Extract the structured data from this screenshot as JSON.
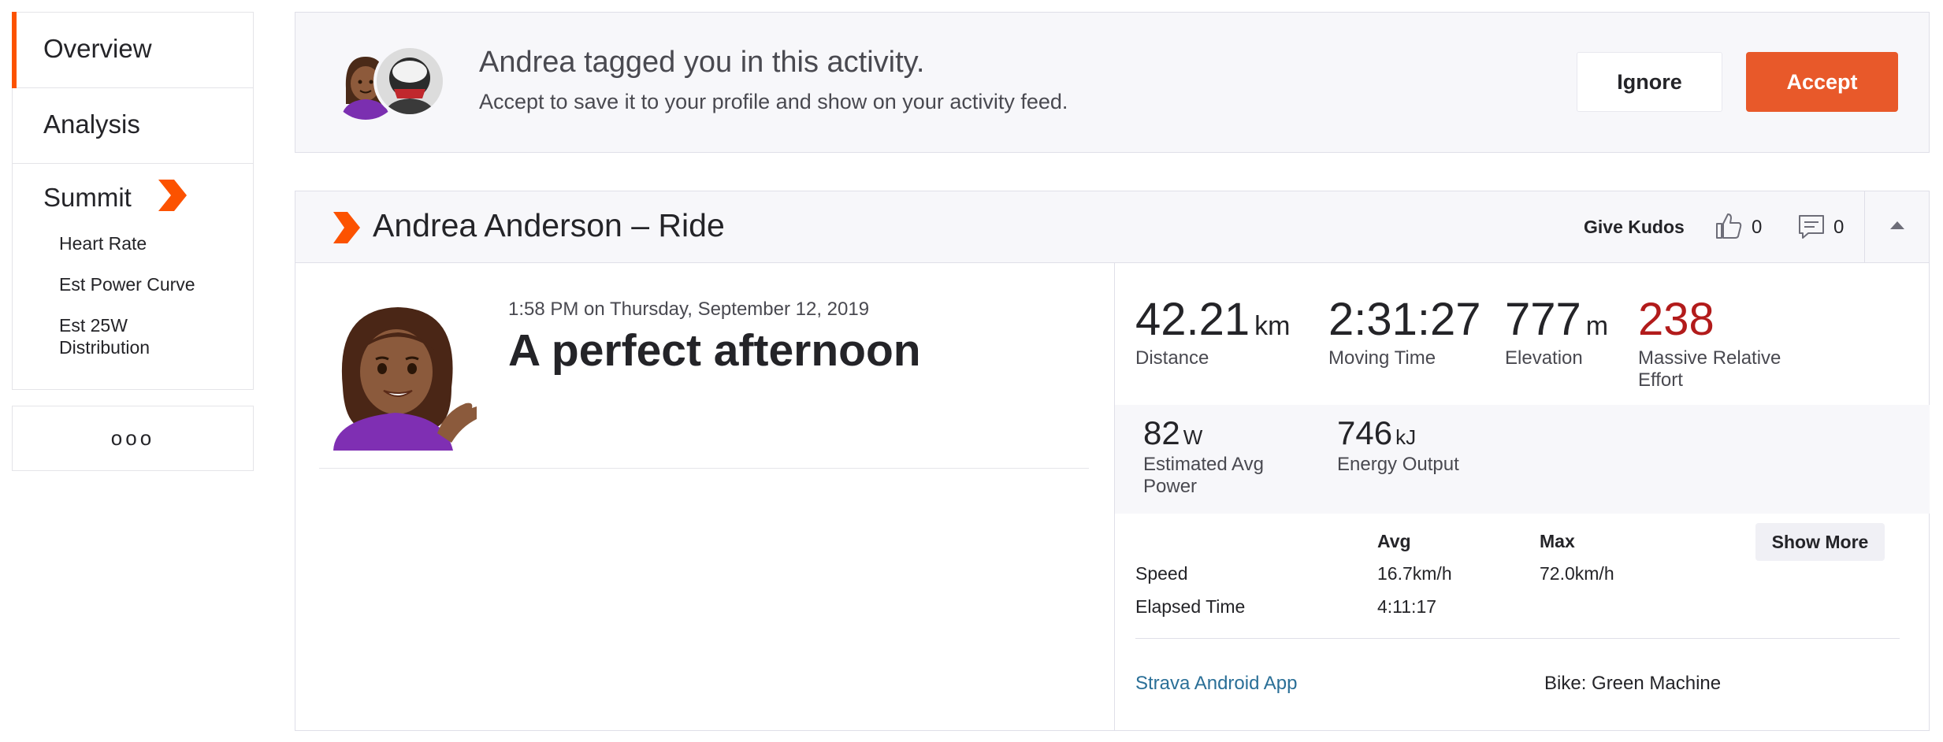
{
  "sidebar": {
    "items": [
      {
        "label": "Overview"
      },
      {
        "label": "Analysis"
      }
    ],
    "summit": {
      "label": "Summit",
      "sub_items": [
        "Heart Rate",
        "Est Power Curve",
        "Est 25W Distribution"
      ]
    },
    "more_label": "ooo"
  },
  "tag_banner": {
    "title": "Andrea tagged you in this activity.",
    "subtitle": "Accept to save it to your profile and show on your activity feed.",
    "ignore_label": "Ignore",
    "accept_label": "Accept"
  },
  "activity": {
    "header_title": "Andrea Anderson – Ride",
    "kudos_label": "Give Kudos",
    "kudos_count": "0",
    "comment_count": "0",
    "time": "1:58 PM on Thursday, September 12, 2019",
    "name": "A perfect afternoon",
    "stats": {
      "distance": {
        "value": "42.21",
        "unit": "km",
        "label": "Distance"
      },
      "moving_time": {
        "value": "2:31:27",
        "label": "Moving Time"
      },
      "elevation": {
        "value": "777",
        "unit": "m",
        "label": "Elevation"
      },
      "relative_effort": {
        "value": "238",
        "label": "Massive Relative Effort"
      }
    },
    "secondary": {
      "power": {
        "value": "82",
        "unit": "W",
        "label": "Estimated Avg Power"
      },
      "energy": {
        "value": "746",
        "unit": "kJ",
        "label": "Energy Output"
      }
    },
    "table": {
      "col_avg": "Avg",
      "col_max": "Max",
      "speed_label": "Speed",
      "speed_avg": "16.7km/h",
      "speed_max": "72.0km/h",
      "elapsed_label": "Elapsed Time",
      "elapsed_avg": "4:11:17"
    },
    "show_more_label": "Show More",
    "device": "Strava Android App",
    "bike": "Bike: Green Machine"
  },
  "colors": {
    "brand_orange": "#fc5200",
    "accept_button": "#e8592a",
    "effort_red": "#b21b1b",
    "link_blue": "#2a6f97"
  }
}
